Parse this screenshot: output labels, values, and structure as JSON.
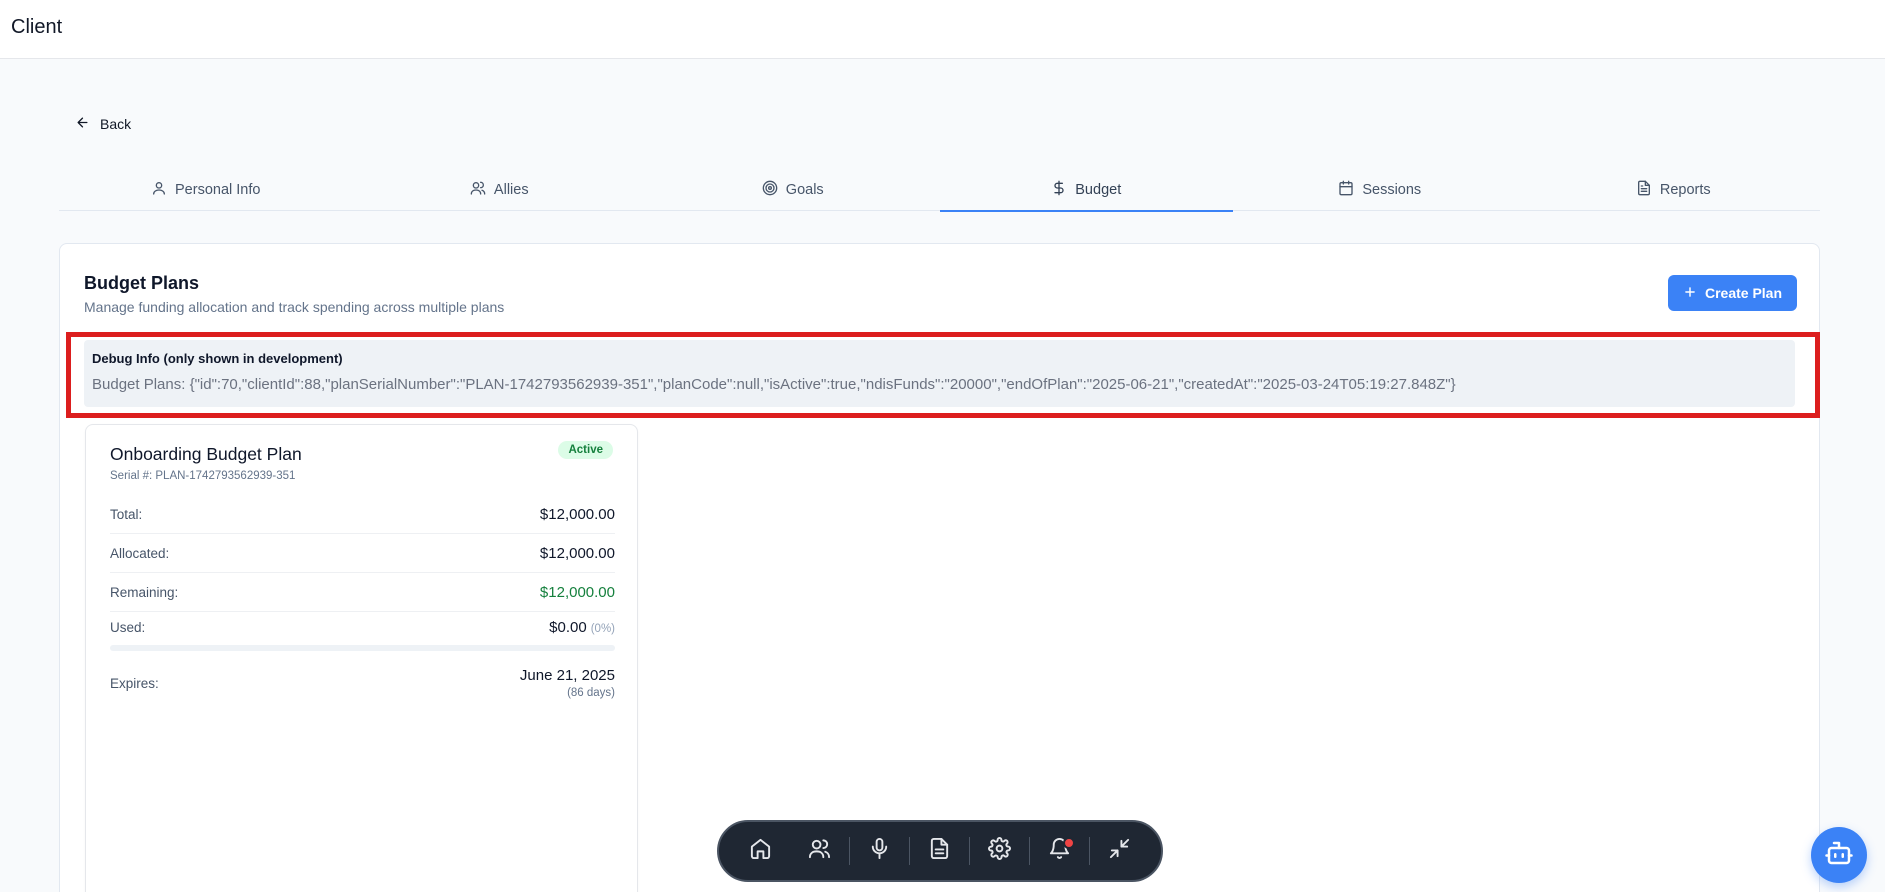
{
  "app": {
    "title": "Client"
  },
  "nav": {
    "back_label": "Back"
  },
  "tabs": [
    {
      "label": "Personal Info",
      "icon": "user-icon"
    },
    {
      "label": "Allies",
      "icon": "users-icon"
    },
    {
      "label": "Goals",
      "icon": "target-icon"
    },
    {
      "label": "Budget",
      "icon": "dollar-icon",
      "active": true
    },
    {
      "label": "Sessions",
      "icon": "calendar-icon"
    },
    {
      "label": "Reports",
      "icon": "file-icon"
    }
  ],
  "budget": {
    "title": "Budget Plans",
    "subtitle": "Manage funding allocation and track spending across multiple plans",
    "create_label": "Create Plan"
  },
  "debug": {
    "title": "Debug Info (only shown in development)",
    "text": "Budget Plans: {\"id\":70,\"clientId\":88,\"planSerialNumber\":\"PLAN-1742793562939-351\",\"planCode\":null,\"isActive\":true,\"ndisFunds\":\"20000\",\"endOfPlan\":\"2025-06-21\",\"createdAt\":\"2025-03-24T05:19:27.848Z\"}"
  },
  "plan": {
    "name": "Onboarding Budget Plan",
    "serial": "Serial #: PLAN-1742793562939-351",
    "status": "Active",
    "total_label": "Total:",
    "total_value": "$12,000.00",
    "allocated_label": "Allocated:",
    "allocated_value": "$12,000.00",
    "remaining_label": "Remaining:",
    "remaining_value": "$12,000.00",
    "used_label": "Used:",
    "used_value": "$0.00",
    "used_pct": "(0%)",
    "used_fraction": 0,
    "expires_label": "Expires:",
    "expires_date": "June 21, 2025",
    "expires_days": "(86 days)"
  },
  "dock": [
    "home-icon",
    "users-icon",
    "microphone-icon",
    "document-icon",
    "settings-icon",
    "bell-icon",
    "minimize-icon"
  ],
  "colors": {
    "accent": "#3b82f6",
    "success": "#15803d",
    "debug_border": "#dc1e1e",
    "dock_bg": "#1f2733"
  }
}
